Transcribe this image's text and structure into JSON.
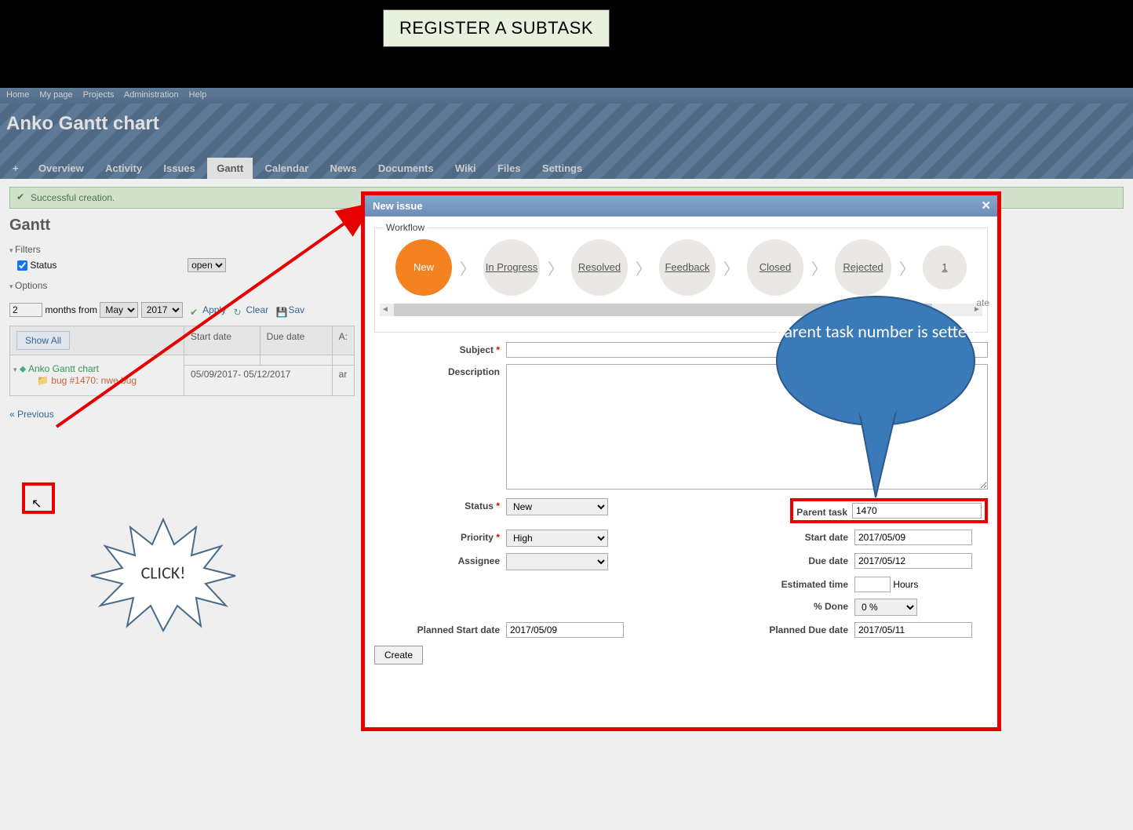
{
  "annotation": {
    "banner": "REGISTER A SUBTASK",
    "click": "CLICK!",
    "callout": "Parent task number is setted"
  },
  "topmenu": {
    "home": "Home",
    "mypage": "My page",
    "projects": "Projects",
    "admin": "Administration",
    "help": "Help"
  },
  "header": {
    "title": "Anko Gantt chart"
  },
  "mainmenu": {
    "plus": "+",
    "overview": "Overview",
    "activity": "Activity",
    "issues": "Issues",
    "gantt": "Gantt",
    "calendar": "Calendar",
    "news": "News",
    "documents": "Documents",
    "wiki": "Wiki",
    "files": "Files",
    "settings": "Settings"
  },
  "flash": "Successful creation.",
  "gantt": {
    "title": "Gantt",
    "filters_legend": "Filters",
    "status_label": "Status",
    "status_value": "open",
    "options_legend": "Options",
    "months_value": "2",
    "months_label": "months from",
    "month_sel": "May",
    "year_sel": "2017",
    "apply": "Apply",
    "clear": "Clear",
    "save": "Sav",
    "showall": "Show All",
    "col_start": "Start date",
    "col_due": "Due date",
    "col_assignee_cut": "A:",
    "project_name": "Anko Gantt chart",
    "issue_text": "bug #1470: nwe bug",
    "date_range": "05/09/2017- 05/12/2017",
    "assignee_cut": "ar",
    "previous": "« Previous"
  },
  "modal": {
    "title": "New issue",
    "workflow_legend": "Workflow",
    "steps": [
      "New",
      "In Progress",
      "Resolved",
      "Feedback",
      "Closed",
      "Rejected",
      "1"
    ],
    "hint_right": "ate",
    "subject_label": "Subject",
    "description_label": "Description",
    "status_label": "Status",
    "status_value": "New",
    "priority_label": "Priority",
    "priority_value": "High",
    "assignee_label": "Assignee",
    "assignee_value": "",
    "parent_label": "Parent task",
    "parent_value": "1470",
    "startdate_label": "Start date",
    "startdate_value": "2017/05/09",
    "duedate_label": "Due date",
    "duedate_value": "2017/05/12",
    "est_label": "Estimated time",
    "est_unit": "Hours",
    "done_label": "% Done",
    "done_value": "0 %",
    "pstart_label": "Planned Start date",
    "pstart_value": "2017/05/09",
    "pdue_label": "Planned Due date",
    "pdue_value": "2017/05/11",
    "create": "Create"
  }
}
